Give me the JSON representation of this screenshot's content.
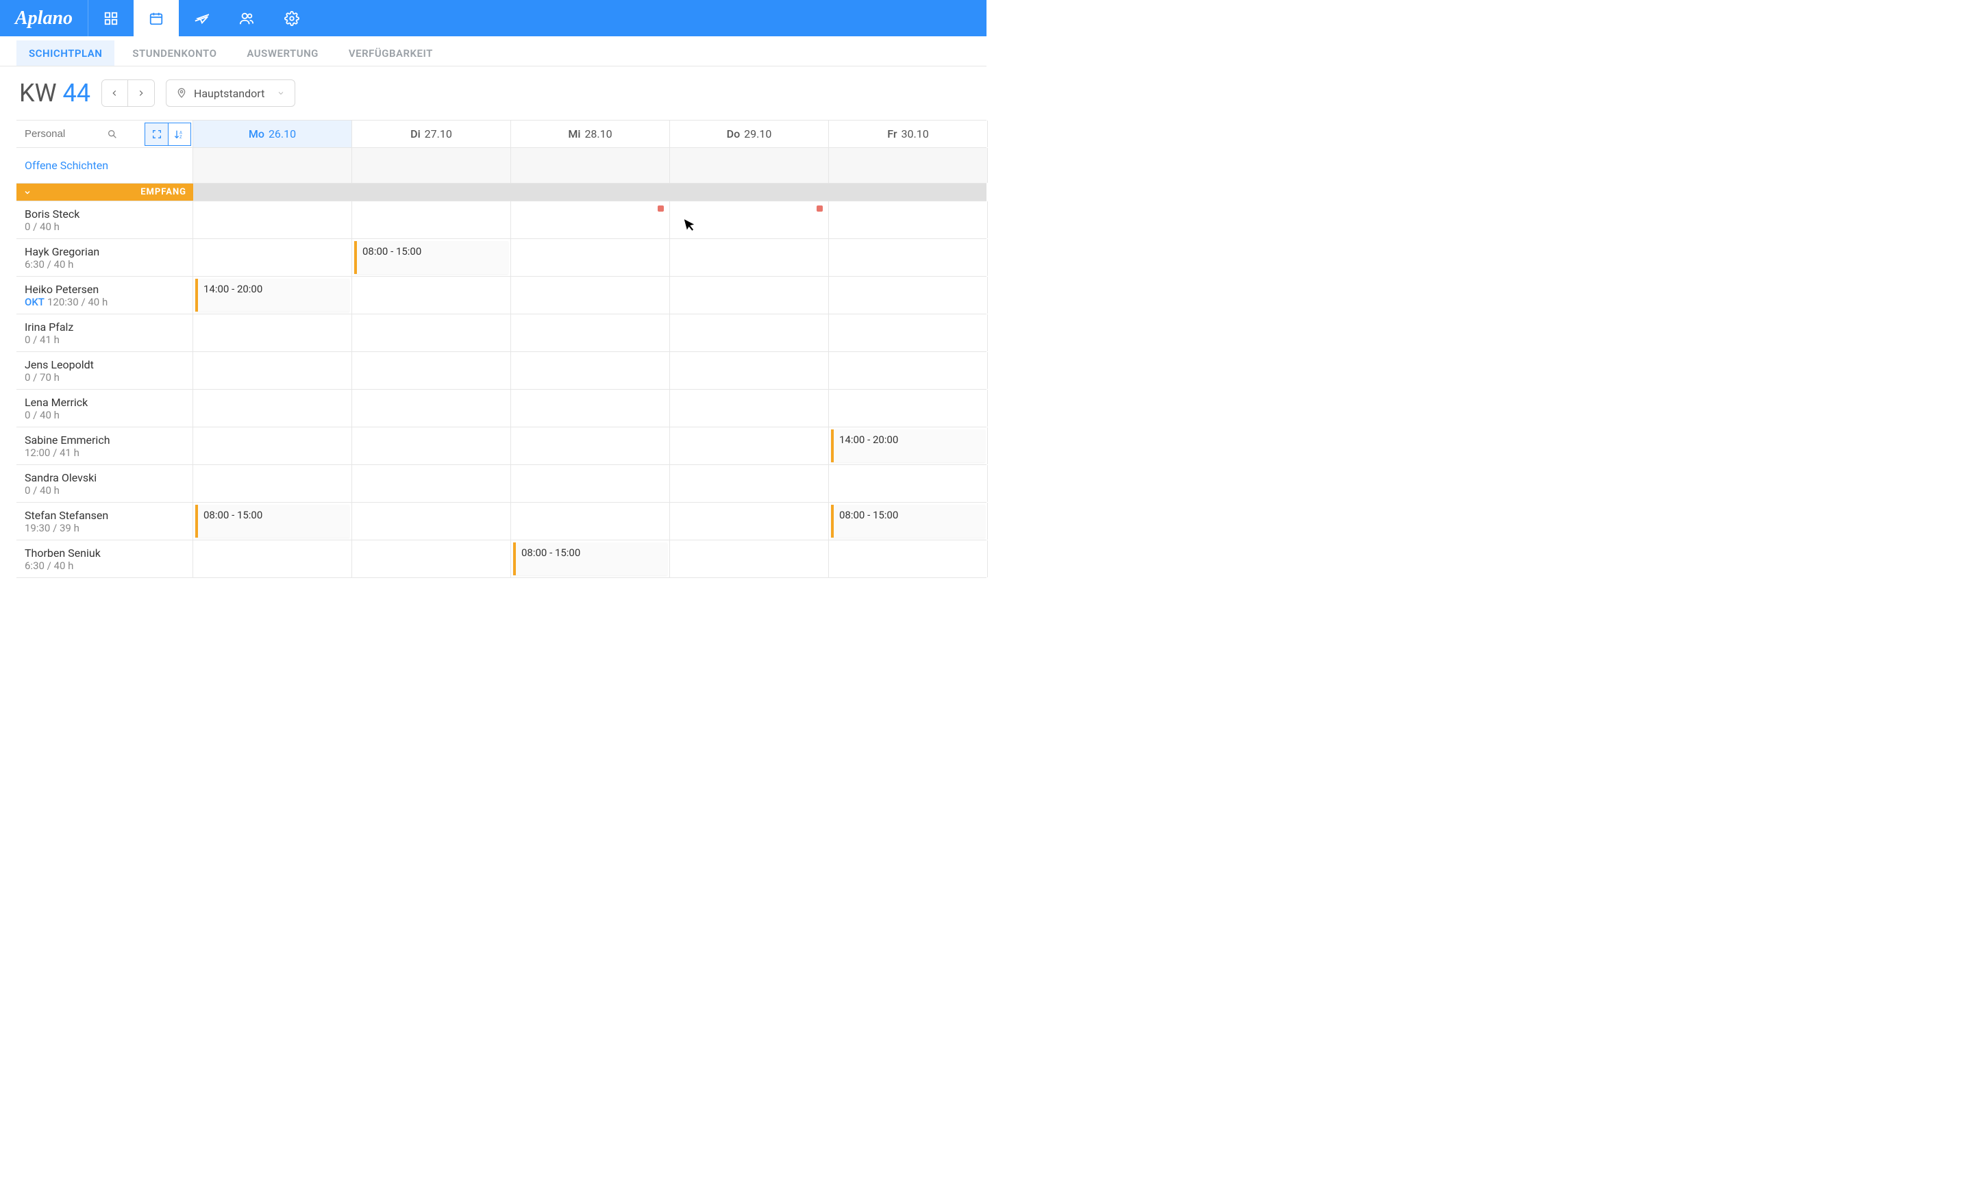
{
  "brand": "Aplano",
  "topnav": [
    {
      "name": "dashboard-icon"
    },
    {
      "name": "calendar-icon"
    },
    {
      "name": "plane-icon"
    },
    {
      "name": "people-icon"
    },
    {
      "name": "gear-icon"
    }
  ],
  "subtabs": [
    "SCHICHTPLAN",
    "STUNDENKONTO",
    "AUSWERTUNG",
    "VERFÜGBARKEIT"
  ],
  "toolbar": {
    "kw_prefix": "KW",
    "kw_number": "44",
    "location": "Hauptstandort"
  },
  "search": {
    "placeholder": "Personal"
  },
  "days": [
    {
      "dow": "Mo",
      "date": "26.10",
      "highlight": true
    },
    {
      "dow": "Di",
      "date": "27.10"
    },
    {
      "dow": "Mi",
      "date": "28.10"
    },
    {
      "dow": "Do",
      "date": "29.10"
    },
    {
      "dow": "Fr",
      "date": "30.10"
    }
  ],
  "open_shifts_label": "Offene Schichten",
  "group_label": "EMPFANG",
  "employees": [
    {
      "name": "Boris Steck",
      "hours": "0 / 40 h",
      "okt": false,
      "markers": [
        2,
        3
      ]
    },
    {
      "name": "Hayk Gregorian",
      "hours": "6:30 / 40 h",
      "okt": false,
      "shifts": [
        {
          "day": 1,
          "label": "08:00 - 15:00"
        }
      ]
    },
    {
      "name": "Heiko Petersen",
      "hours": "120:30 / 40 h",
      "okt": true,
      "shifts": [
        {
          "day": 0,
          "label": "14:00 - 20:00"
        }
      ]
    },
    {
      "name": "Irina Pfalz",
      "hours": "0 / 41 h"
    },
    {
      "name": "Jens Leopoldt",
      "hours": "0 / 70 h"
    },
    {
      "name": "Lena Merrick",
      "hours": "0 / 40 h"
    },
    {
      "name": "Sabine Emmerich",
      "hours": "12:00 / 41 h",
      "shifts": [
        {
          "day": 4,
          "label": "14:00 - 20:00"
        }
      ]
    },
    {
      "name": "Sandra Olevski",
      "hours": "0 / 40 h"
    },
    {
      "name": "Stefan Stefansen",
      "hours": "19:30 / 39 h",
      "shifts": [
        {
          "day": 0,
          "label": "08:00 - 15:00"
        },
        {
          "day": 4,
          "label": "08:00 - 15:00"
        }
      ]
    },
    {
      "name": "Thorben Seniuk",
      "hours": "6:30 / 40 h",
      "shifts": [
        {
          "day": 2,
          "label": "08:00 - 15:00"
        }
      ]
    }
  ],
  "okt_label": "OKT"
}
